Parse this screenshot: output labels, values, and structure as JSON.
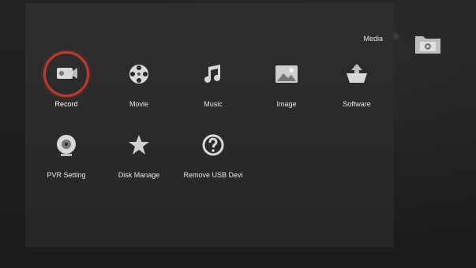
{
  "header": {
    "title": "Media"
  },
  "menu": {
    "items": [
      {
        "label": "Record",
        "icon": "record-icon",
        "selected": true
      },
      {
        "label": "Movie",
        "icon": "film-reel-icon"
      },
      {
        "label": "Music",
        "icon": "music-note-icon"
      },
      {
        "label": "Image",
        "icon": "image-icon"
      },
      {
        "label": "Software",
        "icon": "software-icon"
      },
      {
        "label": "PVR Setting",
        "icon": "pvr-setting-icon"
      },
      {
        "label": "Disk Manage",
        "icon": "star-icon"
      },
      {
        "label": "Remove USB Devi",
        "icon": "question-icon"
      }
    ]
  },
  "sidebar": {
    "icon": "media-folder-icon"
  },
  "colors": {
    "selection_ring": "#c0392b",
    "panel": "#2a2a2a",
    "text": "#e6e6e6"
  }
}
